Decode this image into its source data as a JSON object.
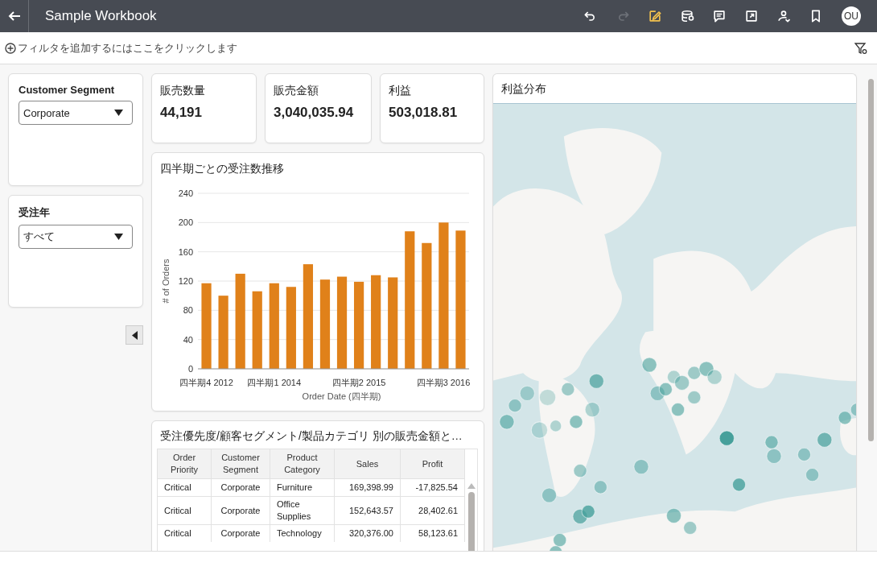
{
  "header": {
    "title": "Sample Workbook",
    "avatar": "OU"
  },
  "toolbar": [
    {
      "kind": "undo",
      "disabled": false,
      "selected": false
    },
    {
      "kind": "redo",
      "disabled": true,
      "selected": false
    },
    {
      "kind": "edit",
      "disabled": false,
      "selected": true
    },
    {
      "kind": "data",
      "disabled": false,
      "selected": false
    },
    {
      "kind": "comment",
      "disabled": false,
      "selected": false
    },
    {
      "kind": "export",
      "disabled": false,
      "selected": false
    },
    {
      "kind": "person",
      "disabled": false,
      "selected": false
    },
    {
      "kind": "bookmark",
      "disabled": false,
      "selected": false
    }
  ],
  "filter_bar": {
    "placeholder": "フィルタを追加するにはここをクリックします"
  },
  "filters": [
    {
      "label": "Customer Segment",
      "value": "Corporate"
    },
    {
      "label": "受注年",
      "value": "すべて"
    }
  ],
  "kpis": [
    {
      "label": "販売数量",
      "value": "44,191"
    },
    {
      "label": "販売金額",
      "value": "3,040,035.94"
    },
    {
      "label": "利益",
      "value": "503,018.81"
    }
  ],
  "bar_panel": {
    "title": "四半期ごとの受注数推移",
    "chart_data": {
      "type": "bar",
      "xlabel": "Order Date (四半期)",
      "ylabel": "# of Orders",
      "categories": [
        "四半期4 2012",
        null,
        null,
        null,
        "四半期1 2014",
        null,
        null,
        null,
        null,
        "四半期2 2015",
        null,
        null,
        null,
        null,
        "四半期3 2016",
        null
      ],
      "grid": true,
      "series": [
        {
          "color": "#e0811a",
          "values": [
            117,
            100,
            130,
            106,
            117,
            112,
            143,
            122,
            126,
            119,
            128,
            125,
            188,
            172,
            200,
            189
          ]
        }
      ],
      "ylim": [
        0,
        240
      ],
      "yticks": [
        0,
        40,
        80,
        120,
        160,
        200,
        240
      ]
    }
  },
  "table_panel": {
    "title": "受注優先度/顧客セグメント/製品カテゴリ 別の販売金額と…",
    "columns": [
      "Order Priority",
      "Customer Segment",
      "Product Category",
      "Sales",
      "Profit"
    ],
    "rows": [
      [
        "Critical",
        "Corporate",
        "Furniture",
        "169,398.99",
        "-17,825.54"
      ],
      [
        "Critical",
        "Corporate",
        "Office Supplies",
        "152,643.57",
        "28,402.61"
      ],
      [
        "Critical",
        "Corporate",
        "Technology",
        "320,376.00",
        "58,123.61"
      ]
    ]
  },
  "map_panel": {
    "title": "利益分布",
    "kind": "picture"
  }
}
